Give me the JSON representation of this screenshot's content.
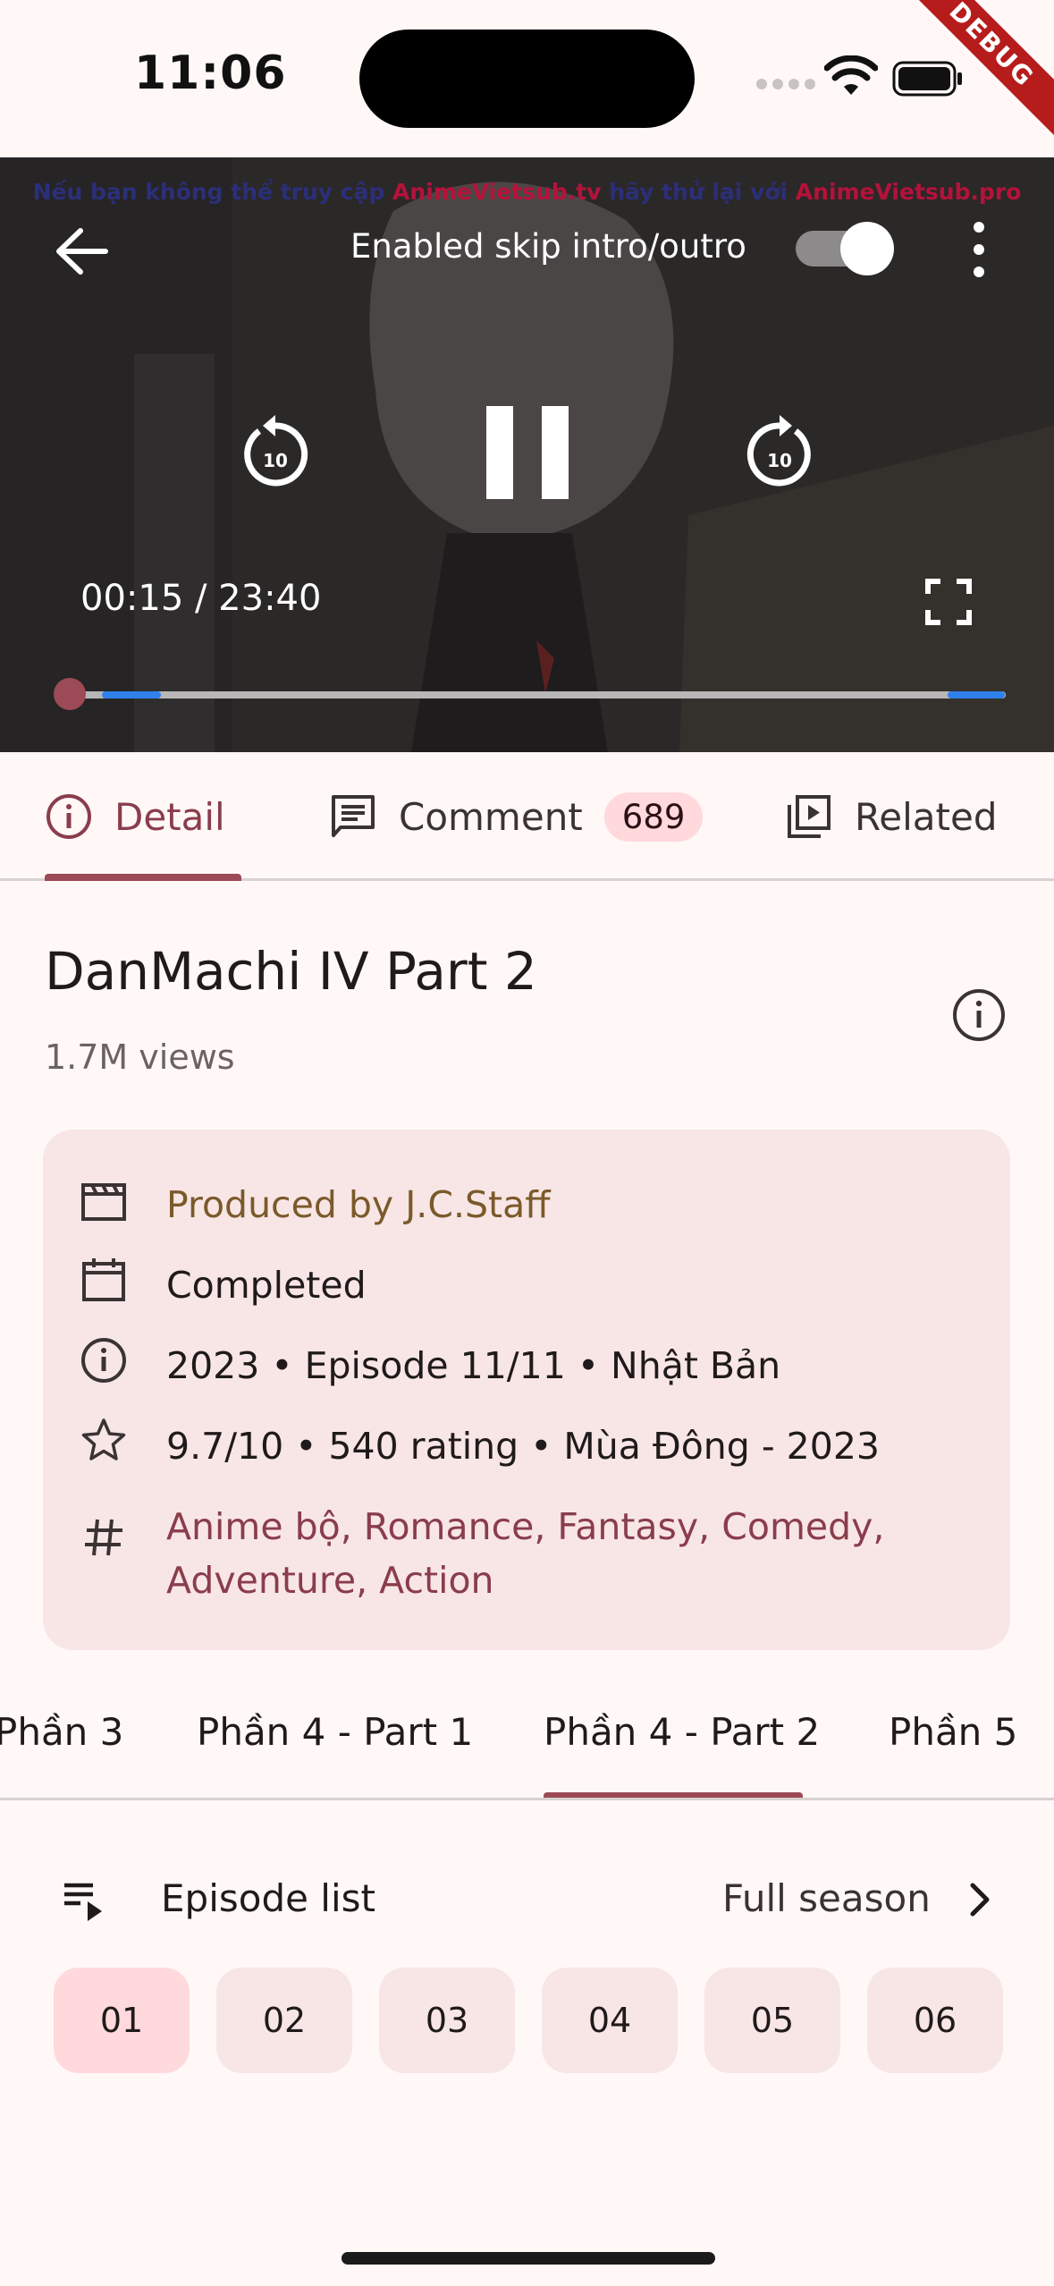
{
  "status": {
    "time": "11:06",
    "debug_label": "DEBUG"
  },
  "player": {
    "marquee_parts": [
      "Nếu bạn không thể truy cập ",
      "AnimeVietsub.tv",
      " hãy thử lại với ",
      "AnimeVietsub.pro"
    ],
    "skip_label": "Enabled skip intro/outro",
    "skip_enabled": true,
    "rewind_seconds": "10",
    "forward_seconds": "10",
    "time": "00:15 / 23:40",
    "progress_fraction": 0.011
  },
  "tabs": {
    "detail": "Detail",
    "comment": "Comment",
    "comment_count": "689",
    "related": "Related"
  },
  "anime": {
    "title": "DanMachi IV Part 2",
    "views": "1.7M views",
    "producer": "Produced by J.C.Staff",
    "status": "Completed",
    "meta": "2023 • Episode 11/11 • Nhật Bản",
    "rating": "9.7/10 • 540 rating • Mùa Đông - 2023",
    "genres": "Anime bộ, Romance, Fantasy, Comedy, Adventure, Action"
  },
  "seasons": [
    "Phần 3",
    "Phần 4 - Part 1",
    "Phần 4 - Part 2",
    "Phần 5"
  ],
  "episode_list": {
    "label": "Episode list",
    "full_season": "Full season",
    "episodes": [
      "01",
      "02",
      "03",
      "04",
      "05",
      "06"
    ]
  },
  "colors": {
    "accent": "#9c4a56",
    "card_bg": "#f8e6e6",
    "active_chip": "#ffd9dc",
    "buffer": "#2f80ed"
  }
}
